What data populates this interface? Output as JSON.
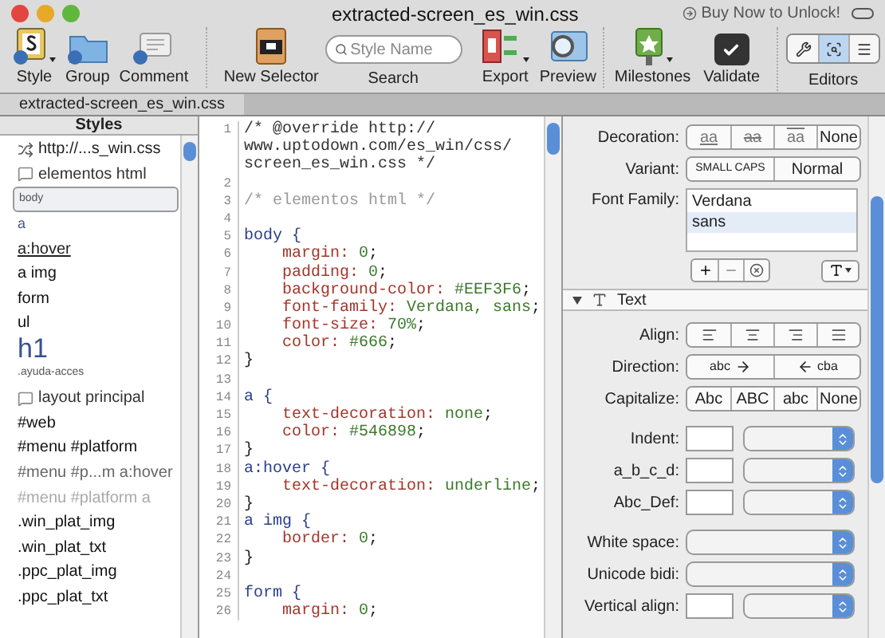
{
  "window": {
    "title": "extracted-screen_es_win.css",
    "promo": "Buy Now to Unlock!"
  },
  "toolbar": {
    "groups": [
      [
        {
          "label": "Style"
        },
        {
          "label": "Group"
        },
        {
          "label": "Comment"
        }
      ],
      [
        {
          "label": "New Selector"
        }
      ],
      [
        {
          "label": "Search"
        }
      ],
      [
        {
          "label": "Export"
        },
        {
          "label": "Preview"
        }
      ],
      [
        {
          "label": "Milestones"
        },
        {
          "label": "Validate"
        }
      ],
      [
        {
          "label": "Editors"
        }
      ]
    ],
    "search_placeholder": "Style Name",
    "editors": [
      {
        "selected": false
      },
      {
        "selected": true
      },
      {
        "selected": false
      }
    ]
  },
  "tabs": [
    {
      "label": "extracted-screen_es_win.css",
      "selected": true
    }
  ],
  "styles": {
    "title": "Styles",
    "items": [
      {
        "kind": "file",
        "text": "http://...s_win.css",
        "selected": false
      },
      {
        "kind": "comment",
        "text": "elementos html",
        "selected": false
      },
      {
        "kind": "tiny",
        "text": "body",
        "selected": true
      },
      {
        "kind": "link",
        "text": "a",
        "selected": false
      },
      {
        "kind": "underline",
        "text": "a:hover",
        "selected": false
      },
      {
        "kind": "rule",
        "text": "a img",
        "selected": false
      },
      {
        "kind": "rule",
        "text": "form",
        "selected": false
      },
      {
        "kind": "rule",
        "text": "ul",
        "selected": false
      },
      {
        "kind": "heading",
        "text": "h1",
        "selected": false
      },
      {
        "kind": "tiny",
        "text": ".ayuda-acces",
        "selected": false
      },
      {
        "kind": "comment",
        "text": "layout principal",
        "selected": false
      },
      {
        "kind": "rule",
        "text": "#web",
        "selected": false
      },
      {
        "kind": "rule",
        "text": "#menu #platform",
        "selected": false
      },
      {
        "kind": "muted",
        "text": "#menu #p...m a:hover",
        "selected": false
      },
      {
        "kind": "faint",
        "text": "#menu #platform a",
        "selected": false
      },
      {
        "kind": "rule",
        "text": ".win_plat_img",
        "selected": false
      },
      {
        "kind": "rule",
        "text": ".win_plat_txt",
        "selected": false
      },
      {
        "kind": "rule",
        "text": ".ppc_plat_img",
        "selected": false
      },
      {
        "kind": "rule",
        "text": ".ppc_plat_txt",
        "selected": false
      }
    ]
  },
  "code": [
    {
      "number": "1",
      "rows": [
        [
          {
            "kind": "comment",
            "text": "/* @override http://"
          }
        ],
        [
          {
            "kind": "comment",
            "text": "www.uptodown.com/es_win/css/"
          }
        ],
        [
          {
            "kind": "comment",
            "text": "screen_es_win.css */"
          }
        ]
      ]
    },
    {
      "number": "2",
      "rows": [
        []
      ]
    },
    {
      "number": "3",
      "rows": [
        [
          {
            "kind": "faint",
            "text": "/* elementos html */"
          }
        ]
      ]
    },
    {
      "number": "4",
      "rows": [
        []
      ]
    },
    {
      "number": "5",
      "rows": [
        [
          {
            "kind": "selector",
            "text": "body {"
          }
        ]
      ]
    },
    {
      "number": "6",
      "rows": [
        [
          {
            "kind": "property",
            "text": "    margin: "
          },
          {
            "kind": "value",
            "text": "0"
          },
          {
            "kind": "plain",
            "text": ";"
          }
        ]
      ]
    },
    {
      "number": "7",
      "rows": [
        [
          {
            "kind": "property",
            "text": "    padding: "
          },
          {
            "kind": "value",
            "text": "0"
          },
          {
            "kind": "plain",
            "text": ";"
          }
        ]
      ]
    },
    {
      "number": "8",
      "rows": [
        [
          {
            "kind": "property",
            "text": "    background-color: "
          },
          {
            "kind": "value",
            "text": "#EEF3F6"
          },
          {
            "kind": "plain",
            "text": ";"
          }
        ]
      ]
    },
    {
      "number": "9",
      "rows": [
        [
          {
            "kind": "property",
            "text": "    font-family: "
          },
          {
            "kind": "value",
            "text": "Verdana, sans"
          },
          {
            "kind": "plain",
            "text": ";"
          }
        ]
      ]
    },
    {
      "number": "10",
      "rows": [
        [
          {
            "kind": "property",
            "text": "    font-size: "
          },
          {
            "kind": "value",
            "text": "70%"
          },
          {
            "kind": "plain",
            "text": ";"
          }
        ]
      ]
    },
    {
      "number": "11",
      "rows": [
        [
          {
            "kind": "property",
            "text": "    color: "
          },
          {
            "kind": "value",
            "text": "#666"
          },
          {
            "kind": "plain",
            "text": ";"
          }
        ]
      ]
    },
    {
      "number": "12",
      "rows": [
        [
          {
            "kind": "plain",
            "text": "}"
          }
        ]
      ]
    },
    {
      "number": "13",
      "rows": [
        []
      ]
    },
    {
      "number": "14",
      "rows": [
        [
          {
            "kind": "selector",
            "text": "a {"
          }
        ]
      ]
    },
    {
      "number": "15",
      "rows": [
        [
          {
            "kind": "property",
            "text": "    text-decoration: "
          },
          {
            "kind": "value",
            "text": "none"
          },
          {
            "kind": "plain",
            "text": ";"
          }
        ]
      ]
    },
    {
      "number": "16",
      "rows": [
        [
          {
            "kind": "property",
            "text": "    color: "
          },
          {
            "kind": "value",
            "text": "#546898"
          },
          {
            "kind": "plain",
            "text": ";"
          }
        ]
      ]
    },
    {
      "number": "17",
      "rows": [
        [
          {
            "kind": "plain",
            "text": "}"
          }
        ]
      ]
    },
    {
      "number": "18",
      "rows": [
        [
          {
            "kind": "selector",
            "text": "a:hover {"
          }
        ]
      ]
    },
    {
      "number": "19",
      "rows": [
        [
          {
            "kind": "property",
            "text": "    text-decoration: "
          },
          {
            "kind": "value",
            "text": "underline"
          },
          {
            "kind": "plain",
            "text": ";"
          }
        ]
      ]
    },
    {
      "number": "20",
      "rows": [
        [
          {
            "kind": "plain",
            "text": "}"
          }
        ]
      ]
    },
    {
      "number": "21",
      "rows": [
        [
          {
            "kind": "selector",
            "text": "a img {"
          }
        ]
      ]
    },
    {
      "number": "22",
      "rows": [
        [
          {
            "kind": "property",
            "text": "    border: "
          },
          {
            "kind": "value",
            "text": "0"
          },
          {
            "kind": "plain",
            "text": ";"
          }
        ]
      ]
    },
    {
      "number": "23",
      "rows": [
        [
          {
            "kind": "plain",
            "text": "}"
          }
        ]
      ]
    },
    {
      "number": "24",
      "rows": [
        []
      ]
    },
    {
      "number": "25",
      "rows": [
        [
          {
            "kind": "selector",
            "text": "form {"
          }
        ]
      ]
    },
    {
      "number": "26",
      "rows": [
        [
          {
            "kind": "property",
            "text": "    margin: "
          },
          {
            "kind": "value",
            "text": "0"
          },
          {
            "kind": "plain",
            "text": ";"
          }
        ]
      ]
    }
  ],
  "inspector": {
    "decoration": {
      "label": "Decoration:",
      "options": [
        {
          "text": "aa",
          "kind": "underline"
        },
        {
          "text": "aa",
          "kind": "strike"
        },
        {
          "text": "aa",
          "kind": "overline"
        },
        {
          "text": "None",
          "kind": "plain"
        }
      ]
    },
    "variant": {
      "label": "Variant:",
      "options": [
        "SMALL CAPS",
        "Normal"
      ]
    },
    "font_family": {
      "label": "Font Family:",
      "items": [
        {
          "text": "Verdana",
          "selected": false
        },
        {
          "text": "sans",
          "selected": true
        }
      ]
    },
    "section": {
      "title": "Text",
      "expanded": true
    },
    "align": {
      "label": "Align:"
    },
    "direction": {
      "label": "Direction:",
      "options": [
        "abc",
        "cba"
      ]
    },
    "capitalize": {
      "label": "Capitalize:",
      "options": [
        "Abc",
        "ABC",
        "abc",
        "None"
      ]
    },
    "fields": [
      {
        "label": "Indent:",
        "kind": "input-select"
      },
      {
        "label": "a_b_c_d:",
        "kind": "input-select"
      },
      {
        "label": "Abc_Def:",
        "kind": "input-select"
      },
      {
        "label": "White space:",
        "kind": "select"
      },
      {
        "label": "Unicode bidi:",
        "kind": "select"
      },
      {
        "label": "Vertical align:",
        "kind": "input-select"
      }
    ]
  }
}
